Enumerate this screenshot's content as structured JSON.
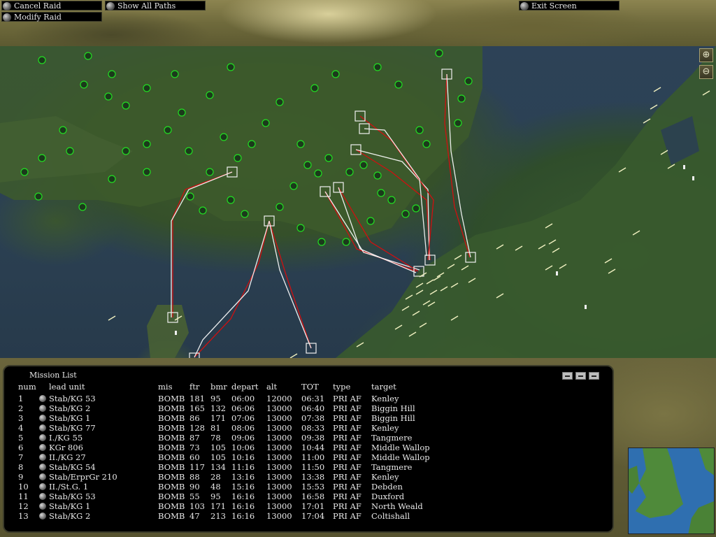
{
  "toolbar": {
    "cancel_raid": "Cancel Raid",
    "show_all_paths": "Show All Paths",
    "modify_raid": "Modify Raid",
    "exit_screen": "Exit Screen"
  },
  "map": {
    "zoom_in_icon": "zoom-in-icon",
    "zoom_out_icon": "zoom-out-icon",
    "route_colors": {
      "outbound": "#d01010",
      "return": "#ffffff"
    },
    "allied_unit_color": "#22cc22",
    "enemy_airfield_color": "#f0f0c0"
  },
  "mission_list": {
    "title": "Mission List",
    "headers": {
      "num": "num",
      "lead_unit": "lead unit",
      "mis": "mis",
      "ftr": "ftr",
      "bmr": "bmr",
      "depart": "depart",
      "alt": "alt",
      "tot": "TOT",
      "type": "type",
      "target": "target"
    },
    "rows": [
      {
        "num": "1",
        "lead_unit": "Stab/KG 53",
        "mis": "BOMB",
        "ftr": "181",
        "bmr": "95",
        "depart": "06:00",
        "alt": "12000",
        "tot": "06:31",
        "type": "PRI AF",
        "target": "Kenley"
      },
      {
        "num": "2",
        "lead_unit": "Stab/KG 2",
        "mis": "BOMB",
        "ftr": "165",
        "bmr": "132",
        "depart": "06:06",
        "alt": "13000",
        "tot": "06:40",
        "type": "PRI AF",
        "target": "Biggin Hill"
      },
      {
        "num": "3",
        "lead_unit": "Stab/KG 1",
        "mis": "BOMB",
        "ftr": "86",
        "bmr": "171",
        "depart": "07:06",
        "alt": "13000",
        "tot": "07:38",
        "type": "PRI AF",
        "target": "Biggin Hill"
      },
      {
        "num": "4",
        "lead_unit": "Stab/KG 77",
        "mis": "BOMB",
        "ftr": "128",
        "bmr": "81",
        "depart": "08:06",
        "alt": "13000",
        "tot": "08:33",
        "type": "PRI AF",
        "target": "Kenley"
      },
      {
        "num": "5",
        "lead_unit": "I./KG 55",
        "mis": "BOMB",
        "ftr": "87",
        "bmr": "78",
        "depart": "09:06",
        "alt": "13000",
        "tot": "09:38",
        "type": "PRI AF",
        "target": "Tangmere"
      },
      {
        "num": "6",
        "lead_unit": "KGr 806",
        "mis": "BOMB",
        "ftr": "73",
        "bmr": "105",
        "depart": "10:06",
        "alt": "13000",
        "tot": "10:44",
        "type": "PRI AF",
        "target": "Middle Wallop"
      },
      {
        "num": "7",
        "lead_unit": "II./KG 27",
        "mis": "BOMB",
        "ftr": "60",
        "bmr": "105",
        "depart": "10:16",
        "alt": "13000",
        "tot": "11:00",
        "type": "PRI AF",
        "target": "Middle Wallop"
      },
      {
        "num": "8",
        "lead_unit": "Stab/KG 54",
        "mis": "BOMB",
        "ftr": "117",
        "bmr": "134",
        "depart": "11:16",
        "alt": "13000",
        "tot": "11:50",
        "type": "PRI AF",
        "target": "Tangmere"
      },
      {
        "num": "9",
        "lead_unit": "Stab/ErprGr 210",
        "mis": "BOMB",
        "ftr": "88",
        "bmr": "28",
        "depart": "13:16",
        "alt": "13000",
        "tot": "13:38",
        "type": "PRI AF",
        "target": "Kenley"
      },
      {
        "num": "10",
        "lead_unit": "II./St.G. 1",
        "mis": "BOMB",
        "ftr": "90",
        "bmr": "48",
        "depart": "15:16",
        "alt": "13000",
        "tot": "15:53",
        "type": "PRI AF",
        "target": "Debden"
      },
      {
        "num": "11",
        "lead_unit": "Stab/KG 53",
        "mis": "BOMB",
        "ftr": "55",
        "bmr": "95",
        "depart": "16:16",
        "alt": "13000",
        "tot": "16:58",
        "type": "PRI AF",
        "target": "Duxford"
      },
      {
        "num": "12",
        "lead_unit": "Stab/KG 1",
        "mis": "BOMB",
        "ftr": "103",
        "bmr": "171",
        "depart": "16:16",
        "alt": "13000",
        "tot": "17:01",
        "type": "PRI AF",
        "target": "North Weald"
      },
      {
        "num": "13",
        "lead_unit": "Stab/KG 2",
        "mis": "BOMB",
        "ftr": "47",
        "bmr": "213",
        "depart": "16:16",
        "alt": "13000",
        "tot": "17:04",
        "type": "PRI AF",
        "target": "Coltishall"
      }
    ]
  }
}
